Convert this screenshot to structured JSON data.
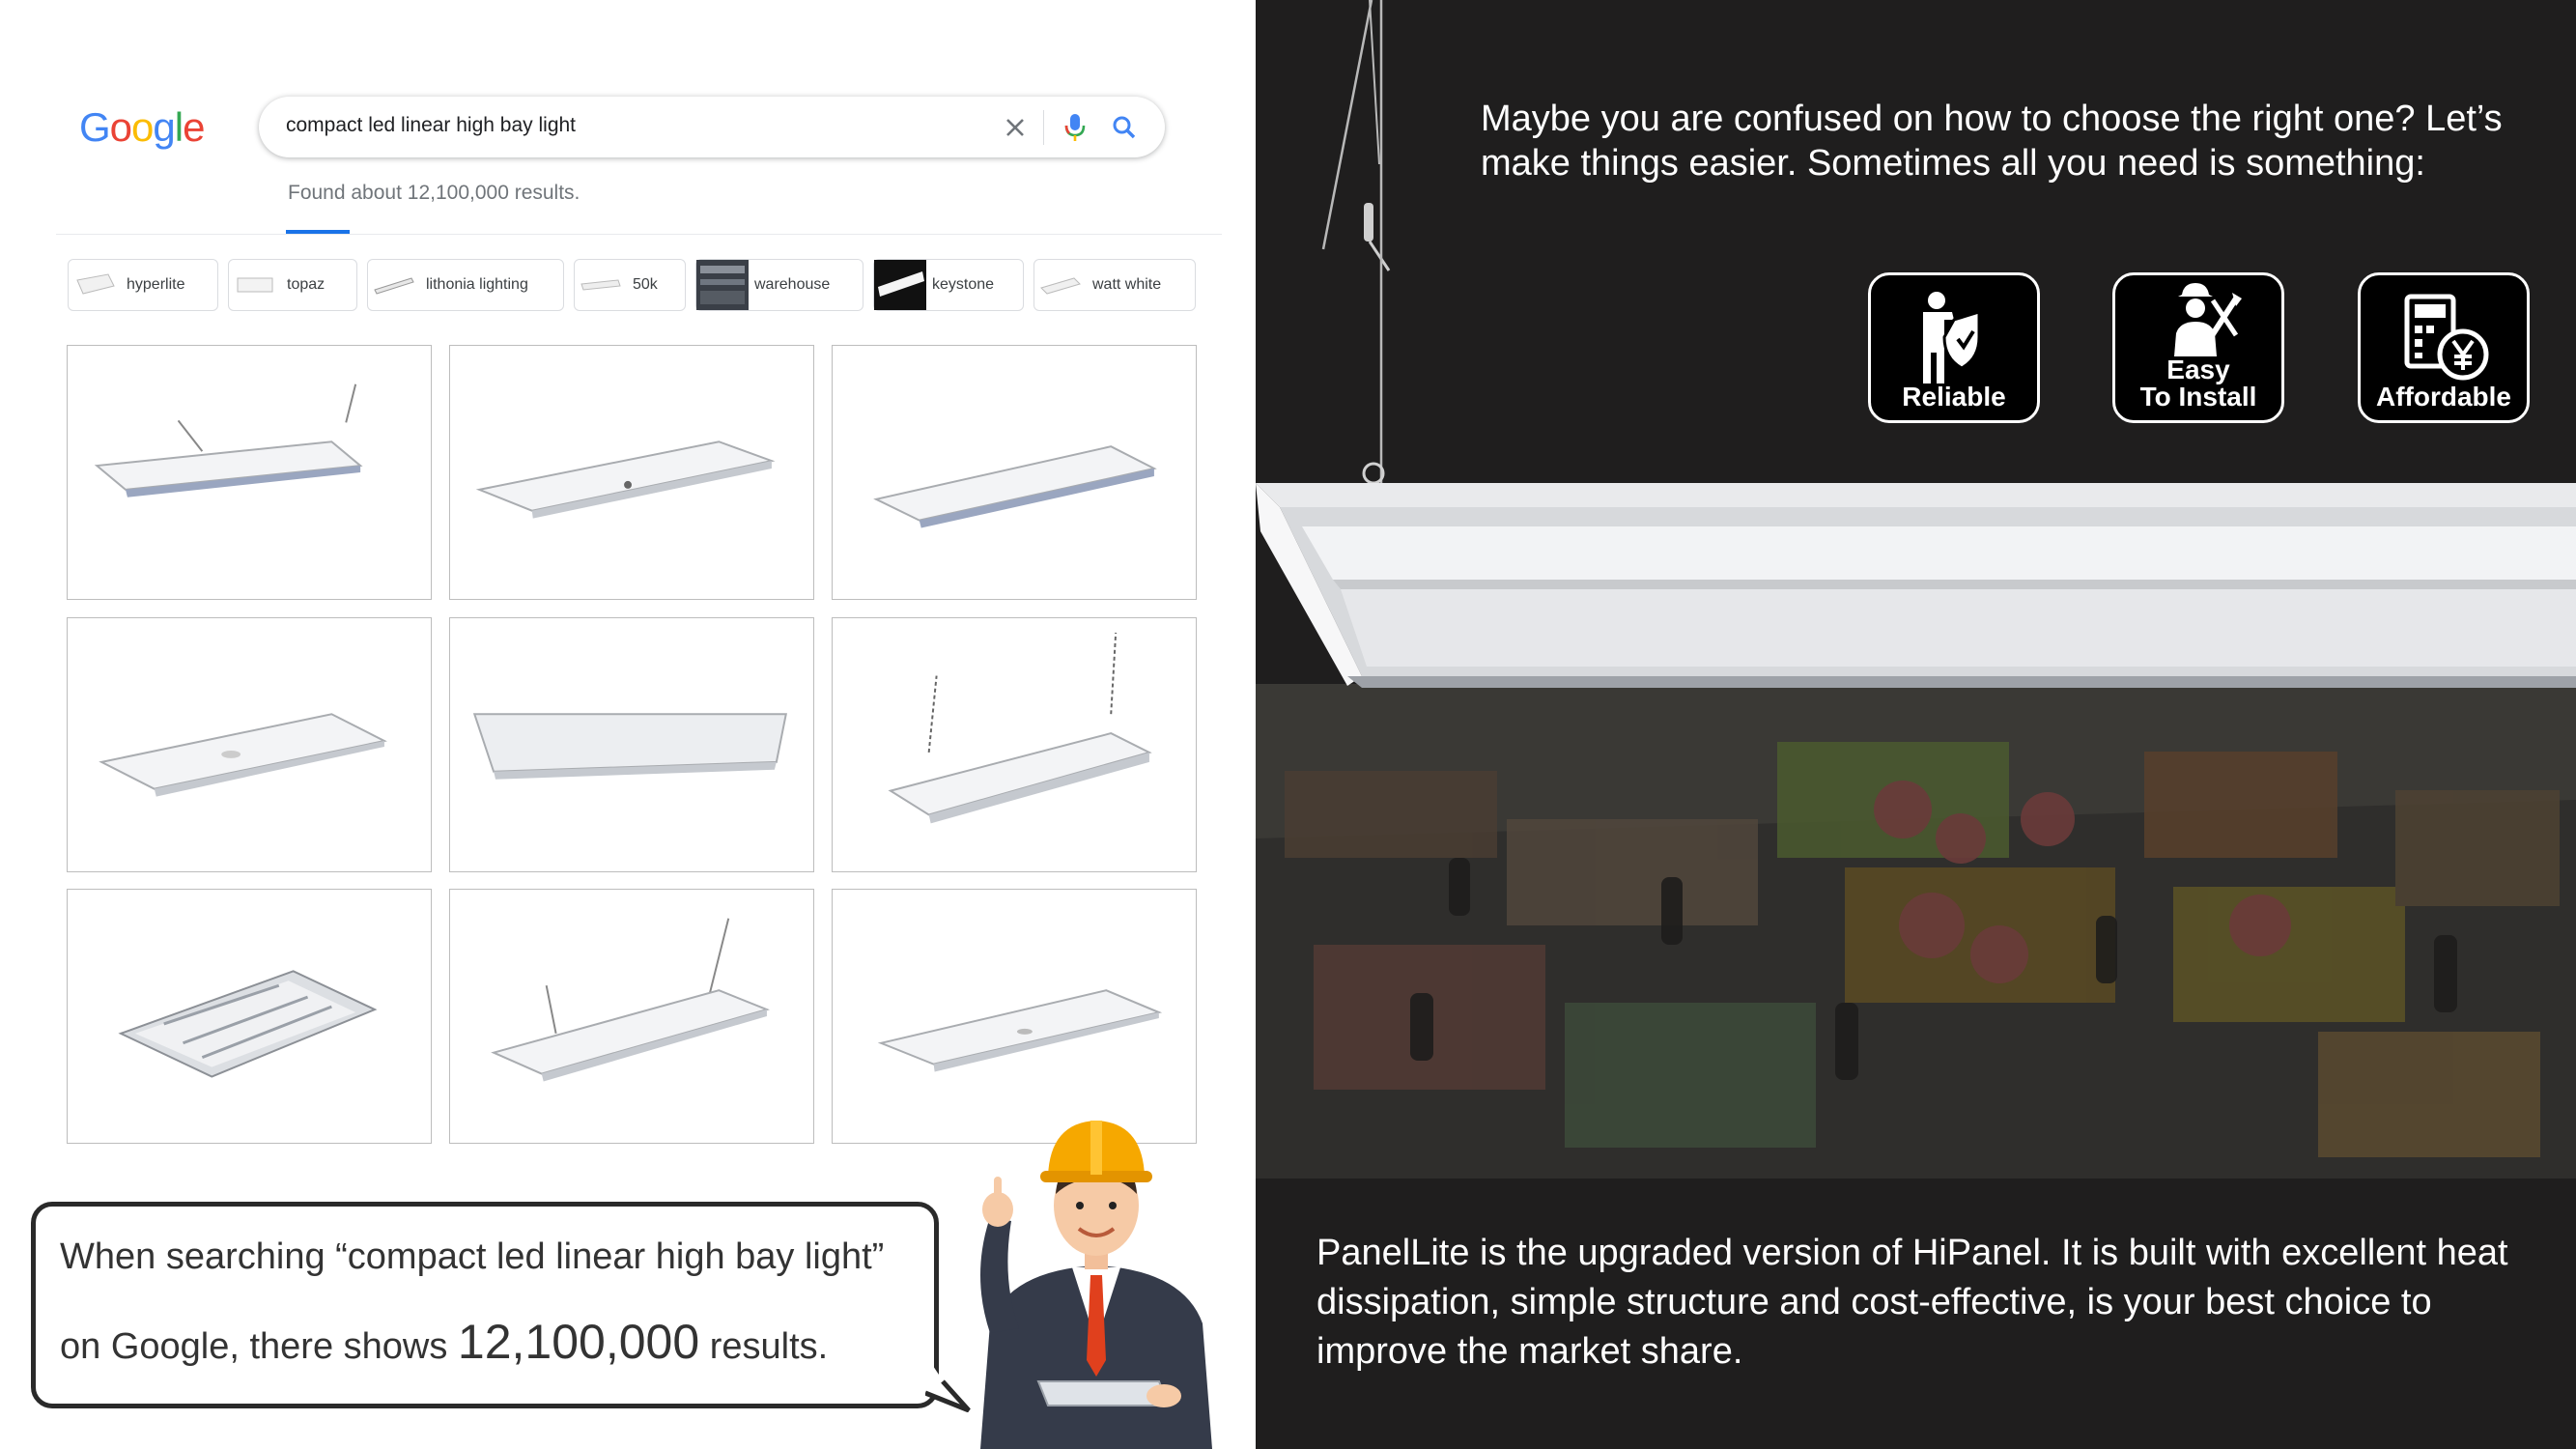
{
  "search": {
    "logo_text": "Google",
    "query": "compact led linear high bay light",
    "results_count": "Found about 12,100,000 results."
  },
  "chips": [
    {
      "label": "hyperlite"
    },
    {
      "label": "topaz"
    },
    {
      "label": "lithonia lighting"
    },
    {
      "label": "50k"
    },
    {
      "label": "warehouse"
    },
    {
      "label": "keystone"
    },
    {
      "label": "watt white"
    }
  ],
  "image_grid": {
    "rows": 3,
    "columns": 3,
    "item_count": 9
  },
  "callout": {
    "line1": "When searching “compact led linear high bay light”",
    "line2_prefix": "on Google, there shows ",
    "line2_number": "12,100,000",
    "line2_suffix": " results."
  },
  "right_panel": {
    "intro_text": "Maybe you are confused on how to choose the right one? Let’s make things easier. Sometimes all you need is something:",
    "features": [
      {
        "label": "Reliable",
        "icon": "person-shield-icon"
      },
      {
        "label": "Easy\nTo Install",
        "icon": "worker-tools-icon"
      },
      {
        "label": "Affordable",
        "icon": "calculator-yen-icon"
      }
    ],
    "description": "PanelLite is the upgraded version of HiPanel. It is built with excellent heat dissipation, simple structure and cost-effective, is your best choice to improve the market share."
  },
  "colors": {
    "dark_background": "#1f1e1e",
    "accent_blue": "#1a73e8",
    "text_gray": "#70757a"
  }
}
